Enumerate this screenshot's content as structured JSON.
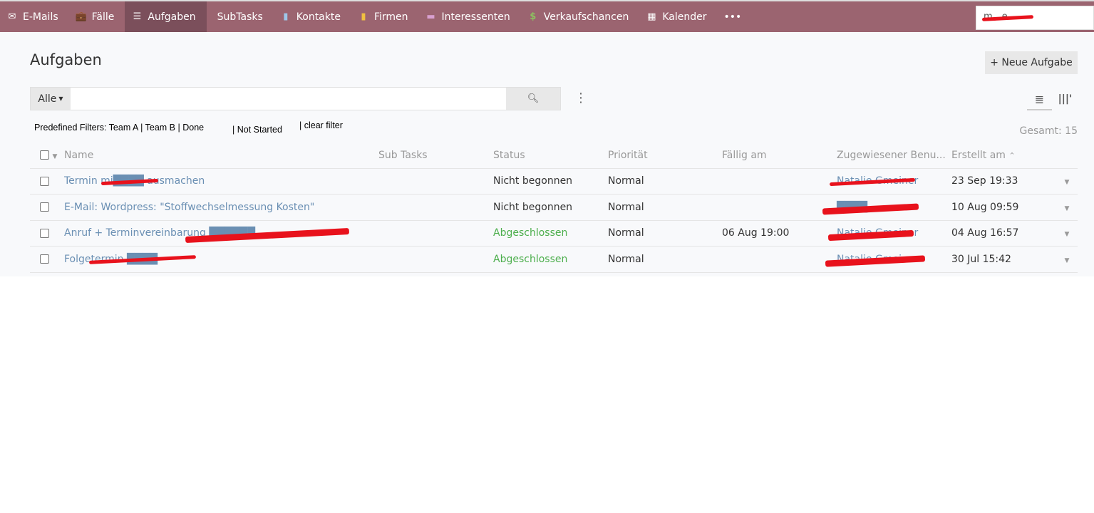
{
  "nav": {
    "items": [
      {
        "label": "E-Mails",
        "icon": "envelope-icon"
      },
      {
        "label": "Fälle",
        "icon": "briefcase-icon"
      },
      {
        "label": "Aufgaben",
        "icon": "tasks-icon",
        "active": true
      },
      {
        "label": "SubTasks",
        "icon": ""
      },
      {
        "label": "Kontakte",
        "icon": "contact-card-icon"
      },
      {
        "label": "Firmen",
        "icon": "building-icon"
      },
      {
        "label": "Interessenten",
        "icon": "id-card-icon"
      },
      {
        "label": "Verkaufschancen",
        "icon": "dollar-icon"
      },
      {
        "label": "Kalender",
        "icon": "calendar-icon"
      }
    ],
    "more": "•••",
    "search_value": "m…e"
  },
  "page": {
    "title": "Aufgaben",
    "new_button": "+ Neue Aufgabe",
    "total": "Gesamt: 15"
  },
  "filter": {
    "scope": "Alle",
    "search_placeholder": ""
  },
  "predefined": {
    "label": "Predefined Filters: Team A | Team B | Done",
    "not_started": "| Not Started",
    "clear": "| clear filter"
  },
  "table": {
    "columns": [
      "Name",
      "Sub Tasks",
      "Status",
      "Priorität",
      "Fällig am",
      "Zugewiesener Benu...",
      "Erstellt am"
    ],
    "rows": [
      {
        "name": "Termin mi████ ausmachen",
        "subtasks": "",
        "status": "Nicht begonnen",
        "priority": "Normal",
        "due": "",
        "assigned": "Natalie Gmeiner",
        "created": "23 Sep 19:33"
      },
      {
        "name": "E-Mail: Wordpress: \"Stoffwechselmessung Kosten\"",
        "subtasks": "",
        "status": "Nicht begonnen",
        "priority": "Normal",
        "due": "",
        "assigned": "████",
        "created": "10 Aug 09:59"
      },
      {
        "name": "Anruf + Terminvereinbarung ██████",
        "subtasks": "",
        "status": "Abgeschlossen",
        "priority": "Normal",
        "due": "06 Aug 19:00",
        "assigned": "Natalie Gmeiner",
        "created": "04 Aug 16:57"
      },
      {
        "name": "Folgetermin ████",
        "subtasks": "",
        "status": "Abgeschlossen",
        "priority": "Normal",
        "due": "",
        "assigned": "Natalie Gmeiner",
        "created": "30 Jul 15:42"
      }
    ]
  },
  "colors": {
    "topbar": "#9b6470",
    "active": "#7b4f5b",
    "link": "#6a8fb3",
    "done": "#4cae4c"
  }
}
